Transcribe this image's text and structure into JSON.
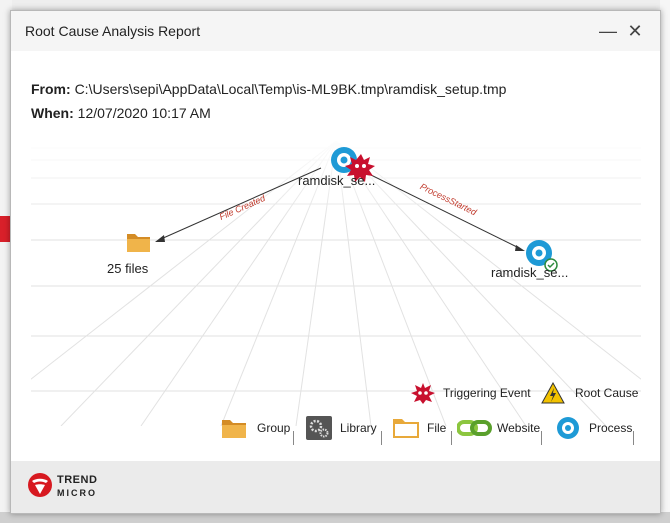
{
  "dialog": {
    "title": "Root Cause Analysis Report",
    "minimize_symbol": "—",
    "close_symbol": "✕"
  },
  "info": {
    "from_label": "From:",
    "from_value": "C:\\Users\\sepi\\AppData\\Local\\Temp\\is-ML9BK.tmp\\ramdisk_setup.tmp",
    "when_label": "When:",
    "when_value": "12/07/2020 10:17 AM"
  },
  "graph": {
    "nodes": [
      {
        "label": "ramdisk_se...",
        "kind": "process",
        "status": "triggering-event"
      },
      {
        "label": "25 files",
        "kind": "file-group"
      },
      {
        "label": "ramdisk_se...",
        "kind": "process",
        "status": "root-cause-ok"
      }
    ],
    "edges": [
      {
        "label": "File Created"
      },
      {
        "label": "ProcessStarted"
      }
    ]
  },
  "legend": {
    "triggering_event": "Triggering Event",
    "root_cause": "Root Cause",
    "group": "Group",
    "library": "Library",
    "file": "File",
    "website": "Website",
    "process": "Process"
  },
  "footer": {
    "logo_line1": "TREND",
    "logo_line2": "MICRO"
  },
  "colors": {
    "accent": "#1e9ad6",
    "alert_red": "#c8102e",
    "folder": "#e8a93a",
    "edge_label": "#c0392b"
  }
}
